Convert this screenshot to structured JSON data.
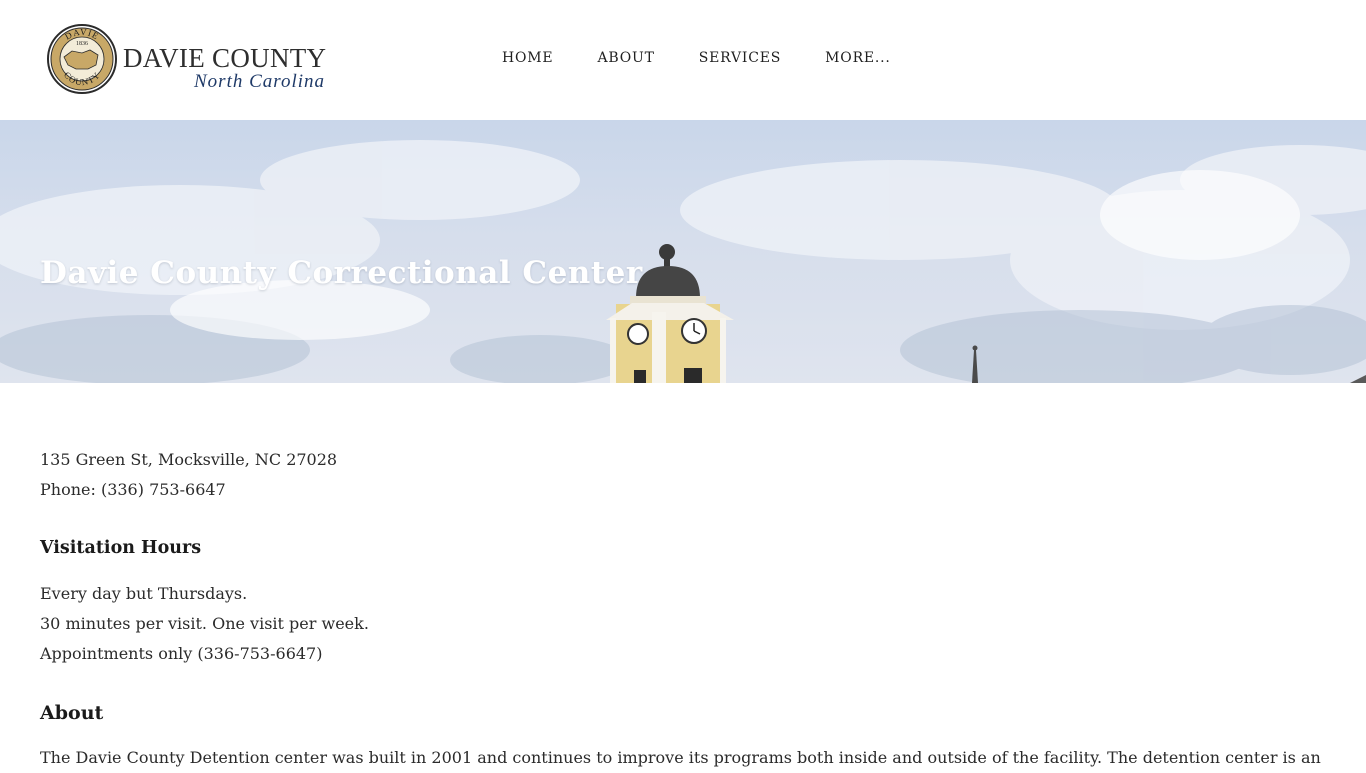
{
  "header": {
    "logo": {
      "seal_top": "DAVIE",
      "seal_year": "1836",
      "seal_bottom": "COUNTY",
      "title": "DAVIE COUNTY",
      "subtitle": "North Carolina"
    },
    "nav": [
      {
        "label": "HOME"
      },
      {
        "label": "ABOUT"
      },
      {
        "label": "SERVICES"
      },
      {
        "label": "MORE..."
      }
    ]
  },
  "hero": {
    "title": "Davie County Correctional Center"
  },
  "content": {
    "address": "135 Green St, Mocksville, NC 27028",
    "phone": "Phone: (336) 753-6647",
    "visitation_heading": "Visitation Hours",
    "visitation_lines": [
      "Every day but Thursdays.",
      "30 minutes per visit.  One visit per week.",
      "Appointments only (336-753-6647)"
    ],
    "about_heading": "About",
    "about_text": "The Davie County Detention center was built in 2001 and continues to improve its programs both inside and outside of the facility. The detention center is an"
  },
  "colors": {
    "nav_text": "#1f1f1f",
    "logo_subtitle": "#1f3a68",
    "seal_gold": "#c8a867",
    "hero_sky": "#d3dcec"
  }
}
